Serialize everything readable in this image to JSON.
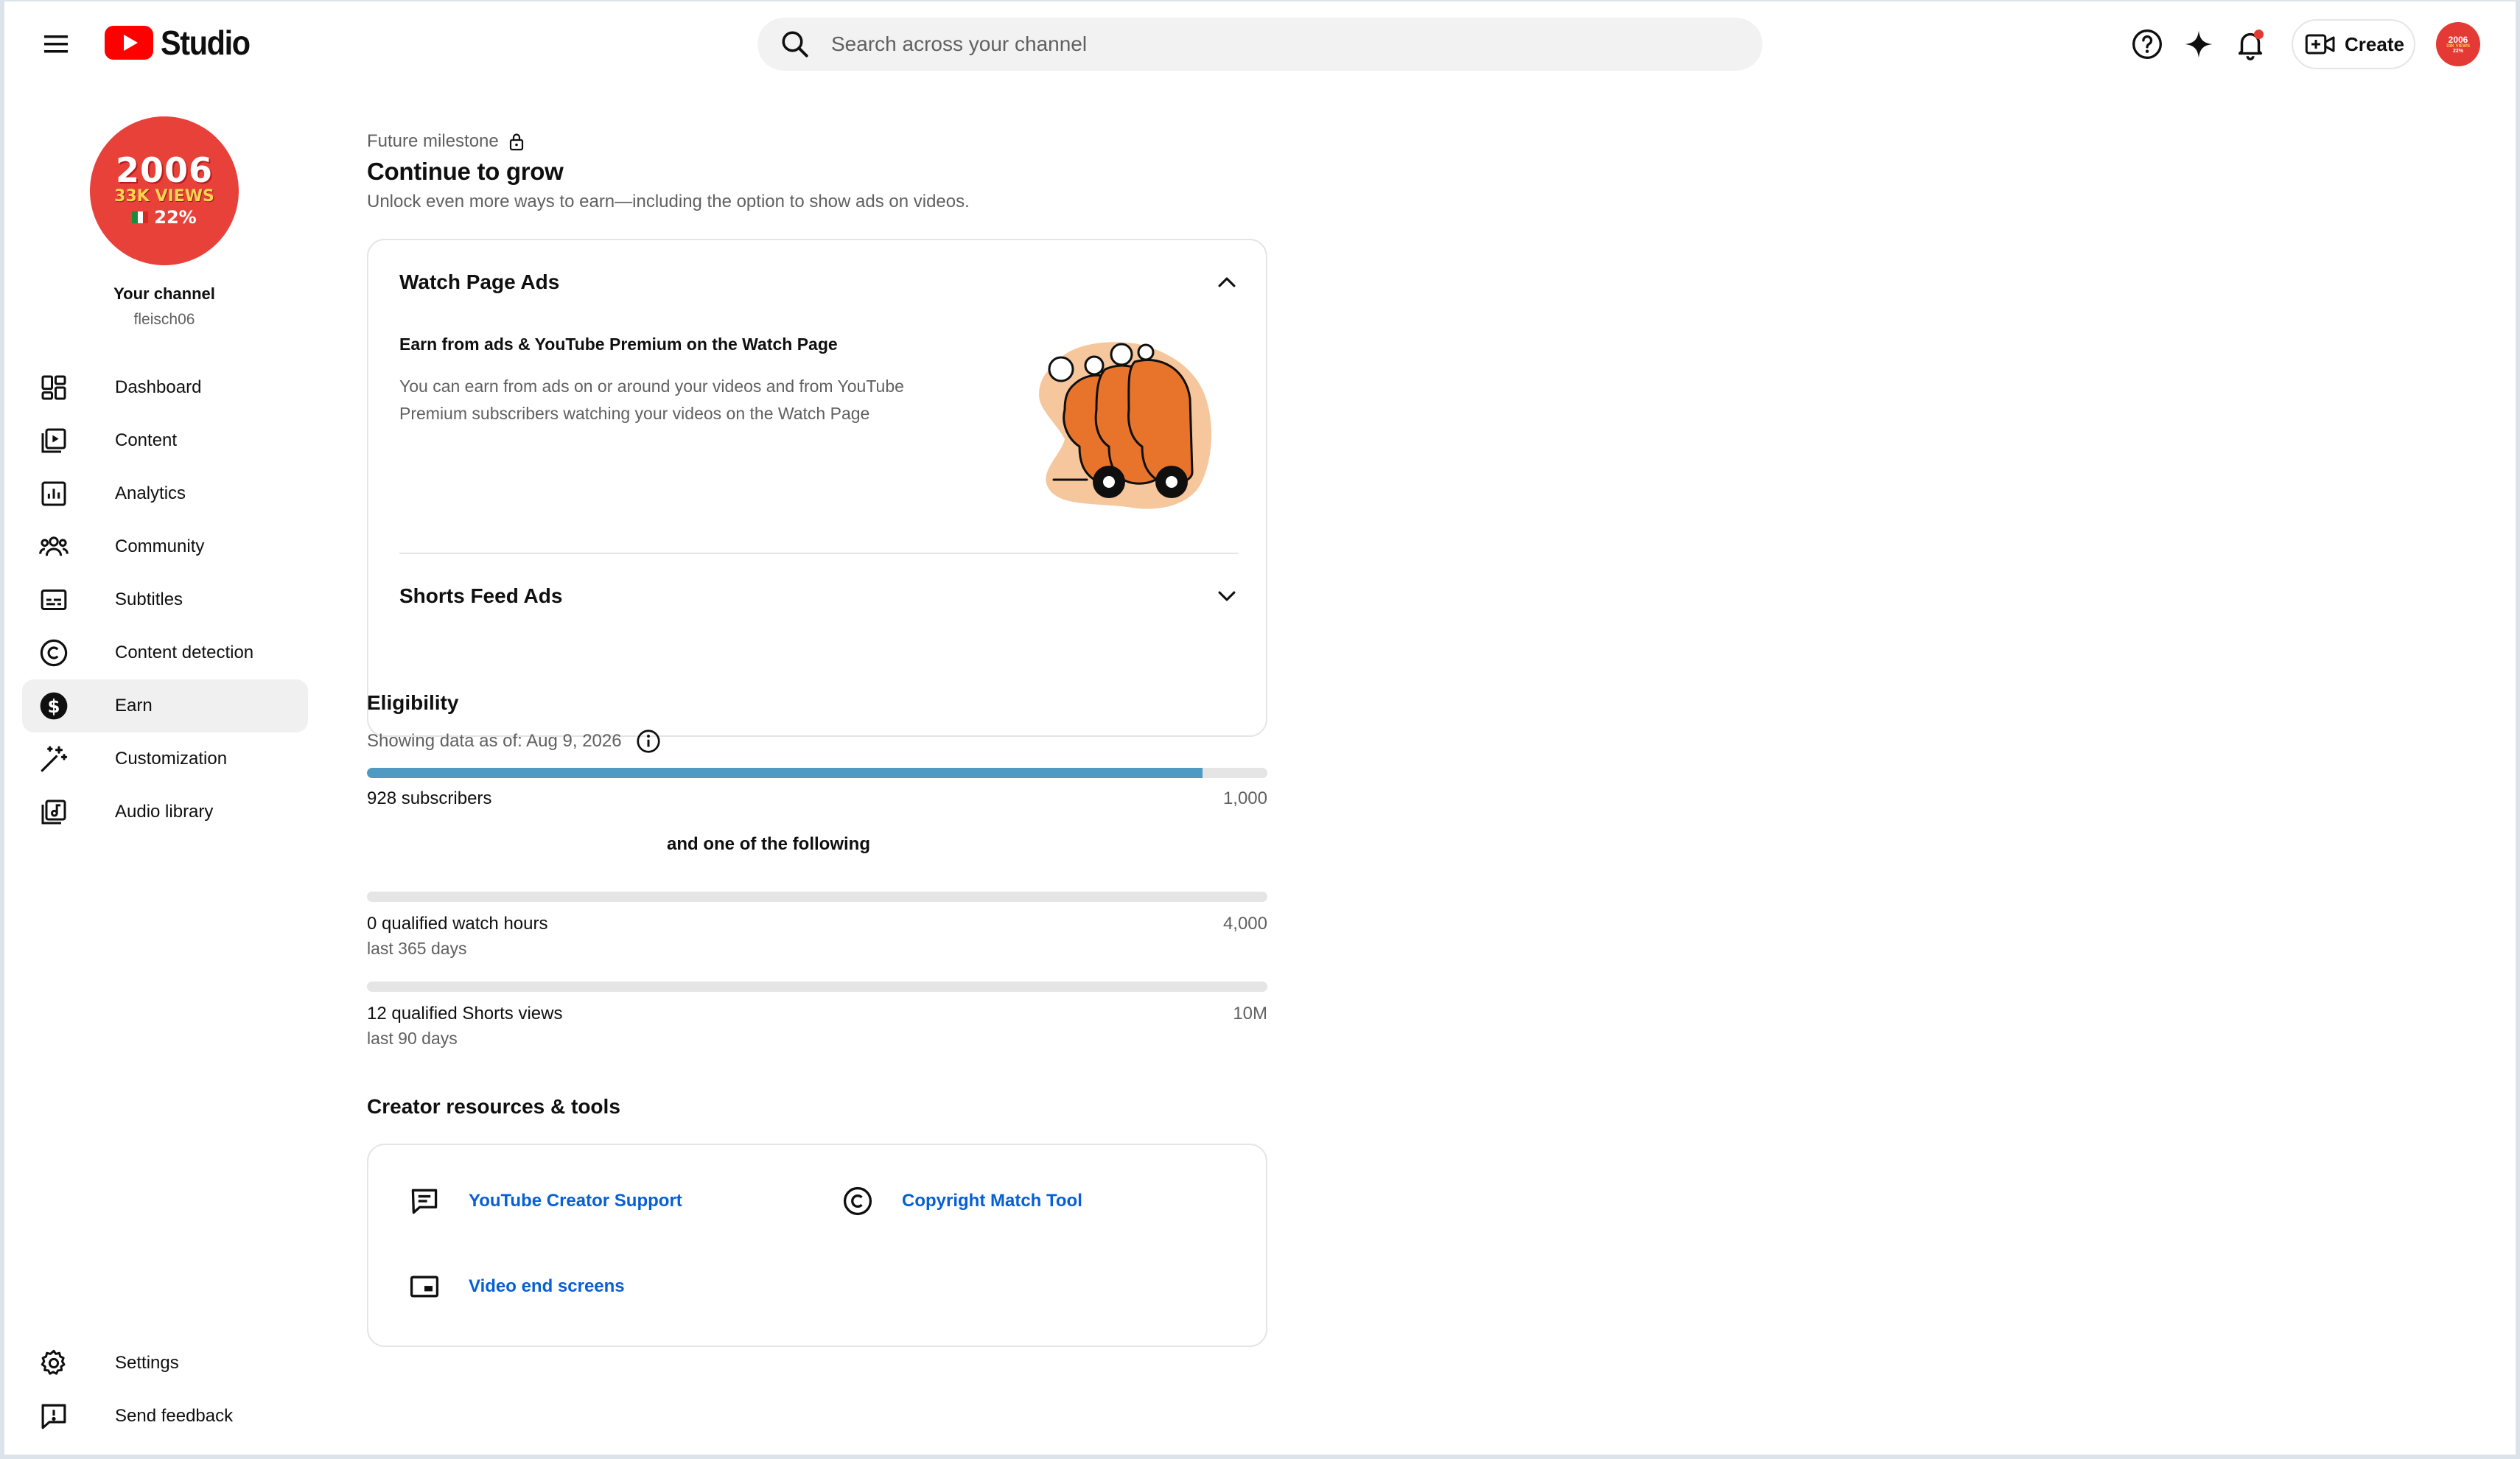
{
  "header": {
    "menu_icon": "hamburger-menu-icon",
    "logo_text": "Studio",
    "search_placeholder": "Search across your channel",
    "create_label": "Create",
    "avatar_lines": [
      "2006",
      "33K VIEWS",
      "22%"
    ]
  },
  "sidebar": {
    "avatar": {
      "line1": "2006",
      "line2": "33K VIEWS",
      "line3": "22%"
    },
    "channel_label": "Your channel",
    "channel_handle": "fleisch06",
    "items": [
      {
        "label": "Dashboard",
        "icon": "dashboard-icon"
      },
      {
        "label": "Content",
        "icon": "content-icon"
      },
      {
        "label": "Analytics",
        "icon": "analytics-icon"
      },
      {
        "label": "Community",
        "icon": "community-icon"
      },
      {
        "label": "Subtitles",
        "icon": "subtitles-icon"
      },
      {
        "label": "Content detection",
        "icon": "copyright-icon"
      },
      {
        "label": "Earn",
        "icon": "dollar-icon",
        "active": true
      },
      {
        "label": "Customization",
        "icon": "magic-wand-icon"
      },
      {
        "label": "Audio library",
        "icon": "audio-library-icon"
      }
    ],
    "bottom_items": [
      {
        "label": "Settings",
        "icon": "gear-icon"
      },
      {
        "label": "Send feedback",
        "icon": "feedback-icon"
      }
    ]
  },
  "main": {
    "milestone_label": "Future milestone",
    "title": "Continue to grow",
    "subtitle": "Unlock even more ways to earn—including the option to show ads on videos.",
    "accordion": [
      {
        "title": "Watch Page Ads",
        "expanded": true,
        "body_title": "Earn from ads & YouTube Premium on the Watch Page",
        "body_text": "You can earn from ads on or around your videos and from YouTube Premium subscribers watching your videos on the Watch Page"
      },
      {
        "title": "Shorts Feed Ads",
        "expanded": false
      }
    ],
    "eligibility": {
      "title": "Eligibility",
      "date_text": "Showing data as of: Aug 9, 2026",
      "and_one_text": "and one of the following",
      "subscribers": {
        "label": "928 subscribers",
        "goal": "1,000",
        "progress": 0.928
      },
      "watch_hours": {
        "label": "0 qualified watch hours",
        "goal": "4,000",
        "period": "last 365 days",
        "progress": 0
      },
      "shorts_views": {
        "label": "12 qualified Shorts views",
        "goal": "10M",
        "period": "last 90 days",
        "progress": 1.2e-06
      }
    },
    "resources": {
      "title": "Creator resources & tools",
      "links": [
        {
          "label": "YouTube Creator Support",
          "icon": "chat-support-icon"
        },
        {
          "label": "Copyright Match Tool",
          "icon": "copyright-icon"
        },
        {
          "label": "Video end screens",
          "icon": "end-screen-icon"
        }
      ]
    }
  },
  "colors": {
    "brand_red": "#ff0000",
    "link_blue": "#065fd4",
    "progress_blue": "#4e9ac3",
    "illustration_orange": "#e8742c"
  }
}
